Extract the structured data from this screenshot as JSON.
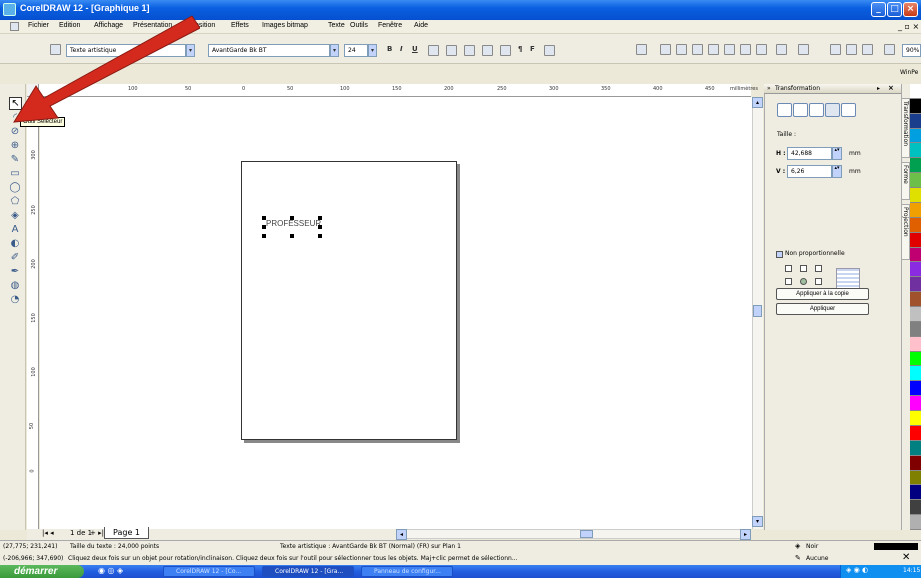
{
  "window": {
    "title": "CorelDRAW 12 - [Graphique 1]"
  },
  "menu": [
    "Fichier",
    "Edition",
    "Affichage",
    "Présentation",
    "Disposition",
    "Effets",
    "Images bitmap",
    "Texte",
    "Outils",
    "Fenêtre",
    "Aide"
  ],
  "propbar": {
    "font_style": "Texte artistique",
    "font_name": "AvantGarde Bk BT",
    "font_size": "24",
    "zoom": "90%",
    "workspace_label": "WinPe"
  },
  "ruler": {
    "unit": "millimètres",
    "ticks": [
      "150",
      "100",
      "50",
      "0",
      "50",
      "100",
      "150",
      "200",
      "250",
      "300",
      "350",
      "400",
      "450"
    ]
  },
  "ruler_v": {
    "ticks": [
      "300",
      "250",
      "200",
      "150",
      "100",
      "50",
      "0"
    ]
  },
  "tooltip": "Outil Sélecteur",
  "canvas": {
    "text_object": "PROFESSEUR"
  },
  "docker": {
    "title": "Transformation",
    "size_label": "Taille :",
    "h_label": "H :",
    "h_value": "42,688",
    "v_label": "V :",
    "v_value": "6,26",
    "unit": "mm",
    "proportional_label": "Non proportionnelle",
    "apply_copy_label": "Appliquer à la copie",
    "apply_label": "Appliquer",
    "tabs": [
      "Transformation",
      "Forme",
      "Projection"
    ]
  },
  "pagenav": {
    "counter": "1 de 1",
    "page_tab": "Page 1"
  },
  "status": {
    "coords": "(27,775; 231,241)",
    "text_size": "Taille du texte : 24,000 points",
    "object_info": "Texte artistique : AvantGarde Bk BT (Normal) (FR) sur Plan 1",
    "coords2": "(-206,966; 347,690)",
    "hint": "Cliquez deux fois sur un objet pour rotation/inclinaison. Cliquez deux fois sur l'outil pour sélectionner tous les objets. Maj+clic permet de sélectionn...",
    "fill_label": "Noir",
    "outline_label": "Aucune"
  },
  "taskbar": {
    "start_label": "démarrer",
    "items": [
      "CorelDRAW 12 - [Co...",
      "CorelDRAW 12 - [Gra...",
      "Panneau de configur..."
    ],
    "clock": "14:15"
  },
  "colors": {
    "palette": [
      "#FFFFFF",
      "#000000",
      "#1A3E8C",
      "#00A0E0",
      "#00C0C0",
      "#00A050",
      "#6CC04A",
      "#E0E000",
      "#F0A000",
      "#E06000",
      "#E00000",
      "#C00070",
      "#8A2BE2",
      "#7030A0",
      "#A0522D",
      "#C0C0C0",
      "#808080",
      "#FFC0CB",
      "#00FF00",
      "#00FFFF",
      "#0000FF",
      "#FF00FF",
      "#FFFF00",
      "#FF0000",
      "#008080",
      "#800000",
      "#808000",
      "#000080",
      "#404040",
      "#B0B0B0"
    ]
  }
}
